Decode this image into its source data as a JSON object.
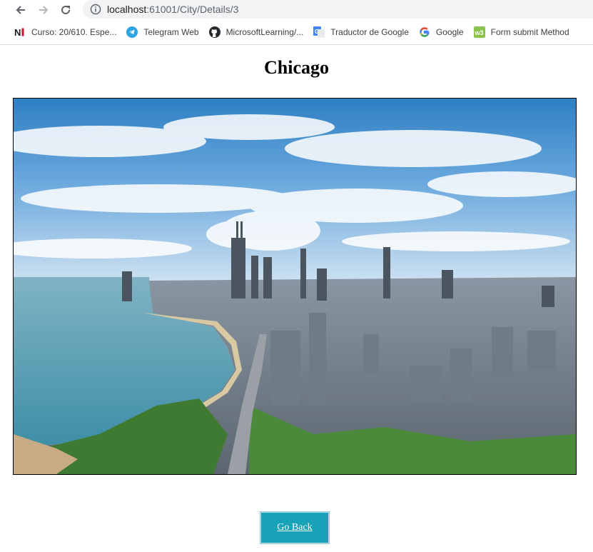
{
  "browser": {
    "url_host": "localhost",
    "url_rest": ":61001/City/Details/3",
    "bookmarks": [
      {
        "label": "Curso: 20/610. Espe...",
        "icon": "ni-logo-icon"
      },
      {
        "label": "Telegram Web",
        "icon": "telegram-icon"
      },
      {
        "label": "MicrosoftLearning/...",
        "icon": "github-icon"
      },
      {
        "label": "Traductor de Google",
        "icon": "google-translate-icon"
      },
      {
        "label": "Google",
        "icon": "google-icon"
      },
      {
        "label": "Form submit Method",
        "icon": "w3schools-icon"
      }
    ]
  },
  "page": {
    "title": "Chicago",
    "image": {
      "subject": "chicago-skyline-photo"
    },
    "back_button_label": "Go Back"
  },
  "colors": {
    "button_bg": "#17a2b8",
    "omnibox_bg": "#f1f3f4"
  }
}
